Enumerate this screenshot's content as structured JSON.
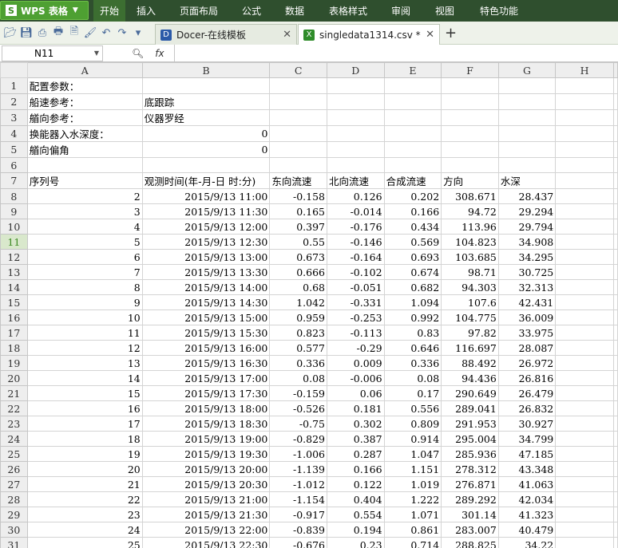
{
  "app": {
    "name": "WPS 表格",
    "logo": "S"
  },
  "menu": {
    "items": [
      "开始",
      "插入",
      "页面布局",
      "公式",
      "数据",
      "表格样式",
      "审阅",
      "视图",
      "特色功能"
    ],
    "active": 0
  },
  "toolbar": {
    "icons": [
      "open-folder-icon",
      "save-icon",
      "export-pdf-icon",
      "print-icon",
      "print-preview-icon",
      "format-painter-icon",
      "undo-icon",
      "redo-icon",
      "dropdown-icon"
    ]
  },
  "tabs": [
    {
      "label": "Docer-在线模板",
      "icon": "docer-icon",
      "active": false
    },
    {
      "label": "singledata1314.csv *",
      "icon": "spreadsheet-icon",
      "active": true
    }
  ],
  "formula_bar": {
    "cell_ref": "N11",
    "value": ""
  },
  "columns": [
    "A",
    "B",
    "C",
    "D",
    "E",
    "F",
    "G",
    "H"
  ],
  "selected_row": 11,
  "config_rows": [
    {
      "row": 1,
      "a": "配置参数：",
      "b": ""
    },
    {
      "row": 2,
      "a": "船速参考：",
      "b": "底跟踪"
    },
    {
      "row": 3,
      "a": "艏向参考：",
      "b": "仪器罗经"
    },
    {
      "row": 4,
      "a": "换能器入水深度：",
      "b": "0"
    },
    {
      "row": 5,
      "a": "艏向偏角",
      "b": "0"
    },
    {
      "row": 6,
      "a": "",
      "b": ""
    }
  ],
  "header_row": {
    "row": 7,
    "cells": [
      "序列号",
      "观测时间(年-月-日 时:分)",
      "东向流速",
      "北向流速",
      "合成流速",
      "方向",
      "水深",
      ""
    ]
  },
  "data_rows": [
    {
      "row": 8,
      "cells": [
        "2",
        "2015/9/13 11:00",
        "-0.158",
        "0.126",
        "0.202",
        "308.671",
        "28.437"
      ]
    },
    {
      "row": 9,
      "cells": [
        "3",
        "2015/9/13 11:30",
        "0.165",
        "-0.014",
        "0.166",
        "94.72",
        "29.294"
      ]
    },
    {
      "row": 10,
      "cells": [
        "4",
        "2015/9/13 12:00",
        "0.397",
        "-0.176",
        "0.434",
        "113.96",
        "29.794"
      ]
    },
    {
      "row": 11,
      "cells": [
        "5",
        "2015/9/13 12:30",
        "0.55",
        "-0.146",
        "0.569",
        "104.823",
        "34.908"
      ]
    },
    {
      "row": 12,
      "cells": [
        "6",
        "2015/9/13 13:00",
        "0.673",
        "-0.164",
        "0.693",
        "103.685",
        "34.295"
      ]
    },
    {
      "row": 13,
      "cells": [
        "7",
        "2015/9/13 13:30",
        "0.666",
        "-0.102",
        "0.674",
        "98.71",
        "30.725"
      ]
    },
    {
      "row": 14,
      "cells": [
        "8",
        "2015/9/13 14:00",
        "0.68",
        "-0.051",
        "0.682",
        "94.303",
        "32.313"
      ]
    },
    {
      "row": 15,
      "cells": [
        "9",
        "2015/9/13 14:30",
        "1.042",
        "-0.331",
        "1.094",
        "107.6",
        "42.431"
      ]
    },
    {
      "row": 16,
      "cells": [
        "10",
        "2015/9/13 15:00",
        "0.959",
        "-0.253",
        "0.992",
        "104.775",
        "36.009"
      ]
    },
    {
      "row": 17,
      "cells": [
        "11",
        "2015/9/13 15:30",
        "0.823",
        "-0.113",
        "0.83",
        "97.82",
        "33.975"
      ]
    },
    {
      "row": 18,
      "cells": [
        "12",
        "2015/9/13 16:00",
        "0.577",
        "-0.29",
        "0.646",
        "116.697",
        "28.087"
      ]
    },
    {
      "row": 19,
      "cells": [
        "13",
        "2015/9/13 16:30",
        "0.336",
        "0.009",
        "0.336",
        "88.492",
        "26.972"
      ]
    },
    {
      "row": 20,
      "cells": [
        "14",
        "2015/9/13 17:00",
        "0.08",
        "-0.006",
        "0.08",
        "94.436",
        "26.816"
      ]
    },
    {
      "row": 21,
      "cells": [
        "15",
        "2015/9/13 17:30",
        "-0.159",
        "0.06",
        "0.17",
        "290.649",
        "26.479"
      ]
    },
    {
      "row": 22,
      "cells": [
        "16",
        "2015/9/13 18:00",
        "-0.526",
        "0.181",
        "0.556",
        "289.041",
        "26.832"
      ]
    },
    {
      "row": 23,
      "cells": [
        "17",
        "2015/9/13 18:30",
        "-0.75",
        "0.302",
        "0.809",
        "291.953",
        "30.927"
      ]
    },
    {
      "row": 24,
      "cells": [
        "18",
        "2015/9/13 19:00",
        "-0.829",
        "0.387",
        "0.914",
        "295.004",
        "34.799"
      ]
    },
    {
      "row": 25,
      "cells": [
        "19",
        "2015/9/13 19:30",
        "-1.006",
        "0.287",
        "1.047",
        "285.936",
        "47.185"
      ]
    },
    {
      "row": 26,
      "cells": [
        "20",
        "2015/9/13 20:00",
        "-1.139",
        "0.166",
        "1.151",
        "278.312",
        "43.348"
      ]
    },
    {
      "row": 27,
      "cells": [
        "21",
        "2015/9/13 20:30",
        "-1.012",
        "0.122",
        "1.019",
        "276.871",
        "41.063"
      ]
    },
    {
      "row": 28,
      "cells": [
        "22",
        "2015/9/13 21:00",
        "-1.154",
        "0.404",
        "1.222",
        "289.292",
        "42.034"
      ]
    },
    {
      "row": 29,
      "cells": [
        "23",
        "2015/9/13 21:30",
        "-0.917",
        "0.554",
        "1.071",
        "301.14",
        "41.323"
      ]
    },
    {
      "row": 30,
      "cells": [
        "24",
        "2015/9/13 22:00",
        "-0.839",
        "0.194",
        "0.861",
        "283.007",
        "40.479"
      ]
    },
    {
      "row": 31,
      "cells": [
        "25",
        "2015/9/13 22:30",
        "-0.676",
        "0.23",
        "0.714",
        "288.825",
        "34.22"
      ]
    }
  ]
}
